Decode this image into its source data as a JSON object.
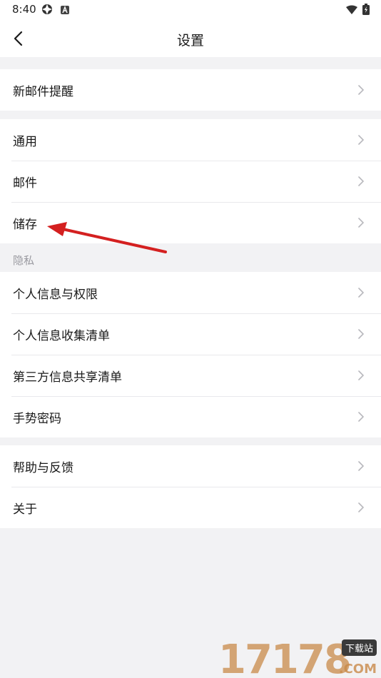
{
  "status_bar": {
    "time": "8:40"
  },
  "nav": {
    "title": "设置"
  },
  "groups": [
    {
      "items": [
        {
          "label": "新邮件提醒"
        }
      ]
    },
    {
      "items": [
        {
          "label": "通用"
        },
        {
          "label": "邮件"
        },
        {
          "label": "储存"
        }
      ]
    },
    {
      "header": "隐私",
      "items": [
        {
          "label": "个人信息与权限"
        },
        {
          "label": "个人信息收集清单"
        },
        {
          "label": "第三方信息共享清单"
        },
        {
          "label": "手势密码"
        }
      ]
    },
    {
      "items": [
        {
          "label": "帮助与反馈"
        },
        {
          "label": "关于"
        }
      ]
    }
  ],
  "watermark": {
    "number": "17178",
    "sub": "下载站",
    "domain": ".COM"
  },
  "colors": {
    "annotation_arrow": "#d42020",
    "background": "#f2f2f4",
    "row_bg": "#ffffff"
  }
}
